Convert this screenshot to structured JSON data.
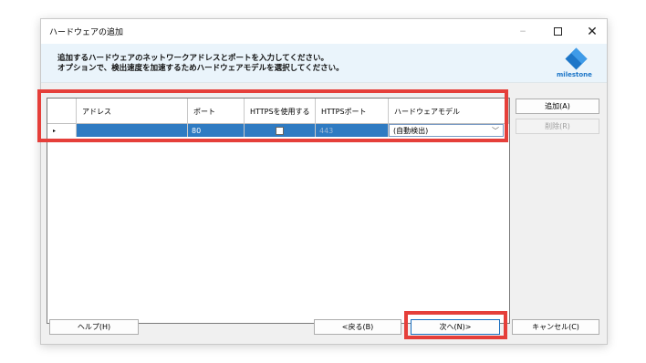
{
  "window": {
    "title": "ハードウェアの追加",
    "controls": {
      "minimize": "−",
      "maximize": "□",
      "close": "✕"
    }
  },
  "header": {
    "instruction_line1": "追加するハードウェアのネットワークアドレスとポートを入力してください。",
    "instruction_line2": "オプションで、検出速度を加速するためハードウェアモデルを選択してください。",
    "logo_text": "milestone",
    "logo_color": "#1d76c8"
  },
  "grid": {
    "columns": [
      "アドレス",
      "ポート",
      "HTTPSを使用する",
      "HTTPSポート",
      "ハードウェアモデル"
    ],
    "rows": [
      {
        "indicator": "▸",
        "address": "",
        "port": "80",
        "https_enabled": false,
        "https_port": "443",
        "hardware_model": "(自動検出)"
      }
    ],
    "selected_row_color": "#2f7bc2"
  },
  "side_buttons": {
    "add": "追加(A)",
    "remove": "削除(R)"
  },
  "footer": {
    "help": "ヘルプ(H)",
    "back": "<戻る(B)",
    "next": "次へ(N)>",
    "cancel": "キャンセル(C)"
  },
  "highlight_color": "#e53f3a"
}
